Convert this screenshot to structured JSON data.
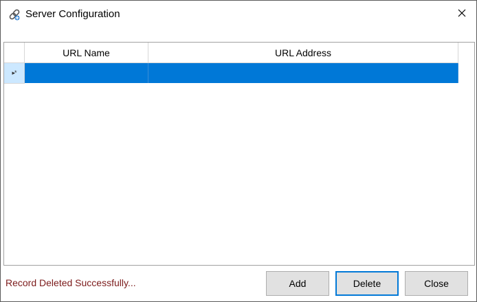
{
  "window": {
    "title": "Server Configuration",
    "app_icon": "network-link-icon",
    "close_icon": "close-icon"
  },
  "grid": {
    "columns": [
      "URL Name",
      "URL Address"
    ],
    "rows": [
      {
        "indicator": "new-row-indicator",
        "indicator_text": "▸*",
        "url_name": "",
        "url_address": "",
        "selected": true
      }
    ],
    "selection_color": "#0078d7",
    "row_header_selected_color": "#cce8ff"
  },
  "status": {
    "message": "Record Deleted Successfully...",
    "color": "#7b1a1a"
  },
  "buttons": {
    "add": "Add",
    "delete": "Delete",
    "close": "Close"
  }
}
